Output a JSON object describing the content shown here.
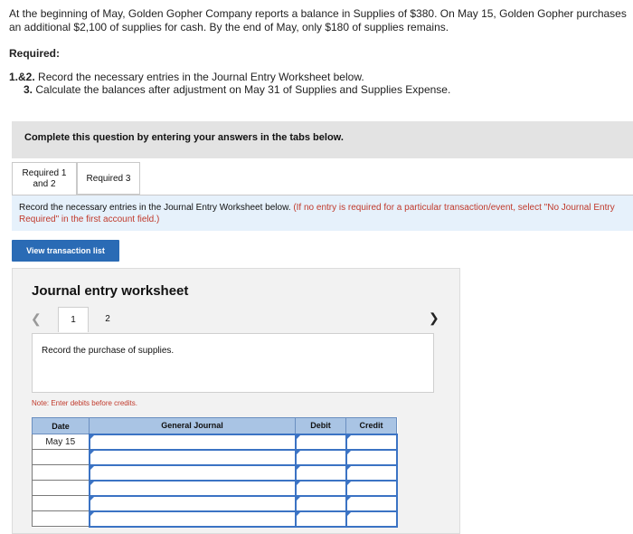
{
  "problem": {
    "text": "At the beginning of May, Golden Gopher Company reports a balance in Supplies of $380. On May 15, Golden Gopher purchases an additional $2,100 of supplies for cash. By the end of May, only $180 of supplies remains.",
    "required_heading": "Required:",
    "req1_num": "1.&2.",
    "req1_text": "Record the necessary entries in the Journal Entry Worksheet below.",
    "req3_num": "3.",
    "req3_text": "Calculate the balances after adjustment on May 31 of Supplies and Supplies Expense."
  },
  "banner": "Complete this question by entering your answers in the tabs below.",
  "tabs": [
    {
      "label_line1": "Required 1",
      "label_line2": "and 2"
    },
    {
      "label": "Required 3"
    }
  ],
  "instruction": {
    "main": "Record the necessary entries in the Journal Entry Worksheet below.",
    "note": "(If no entry is required for a particular transaction/event, select \"No Journal Entry Required\" in the first account field.)"
  },
  "view_button": "View transaction list",
  "worksheet": {
    "title": "Journal entry worksheet",
    "pages": [
      "1",
      "2"
    ],
    "description": "Record the purchase of supplies.",
    "note": "Note: Enter debits before credits.",
    "columns": [
      "Date",
      "General Journal",
      "Debit",
      "Credit"
    ],
    "rows": [
      {
        "date": "May 15"
      },
      {
        "date": ""
      },
      {
        "date": ""
      },
      {
        "date": ""
      },
      {
        "date": ""
      },
      {
        "date": ""
      }
    ]
  }
}
